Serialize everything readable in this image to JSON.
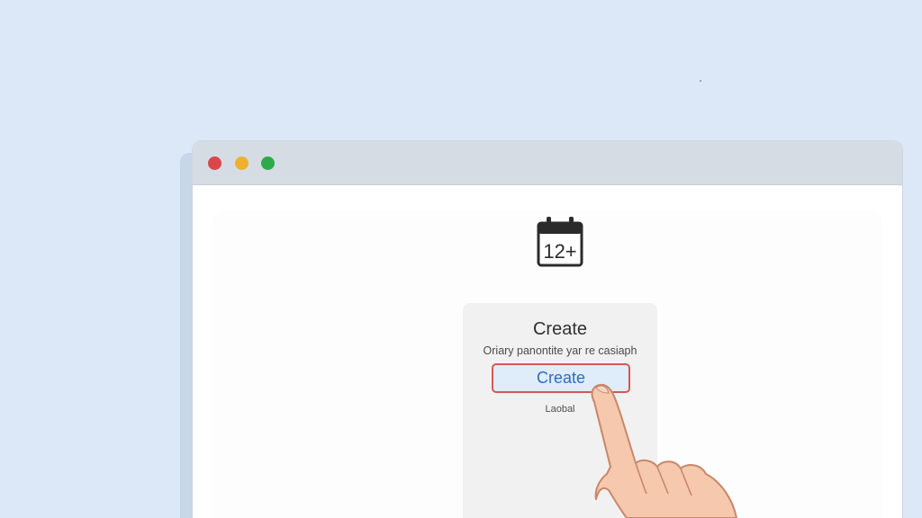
{
  "window": {
    "controls": {
      "close_color": "#d9474a",
      "minimize_color": "#ecb22f",
      "maximize_color": "#2eaa4c"
    }
  },
  "icon": {
    "name": "calendar-icon",
    "text": "12+"
  },
  "dialog": {
    "title": "Create",
    "subtitle": "Oriary panontite yar re casiaph",
    "create_button_label": "Create",
    "cancel_label": "Laobal"
  },
  "colors": {
    "background": "#dce8f8",
    "button_border": "#d05a55",
    "button_text": "#2e6cc0",
    "button_fill": "#dfecfa"
  }
}
